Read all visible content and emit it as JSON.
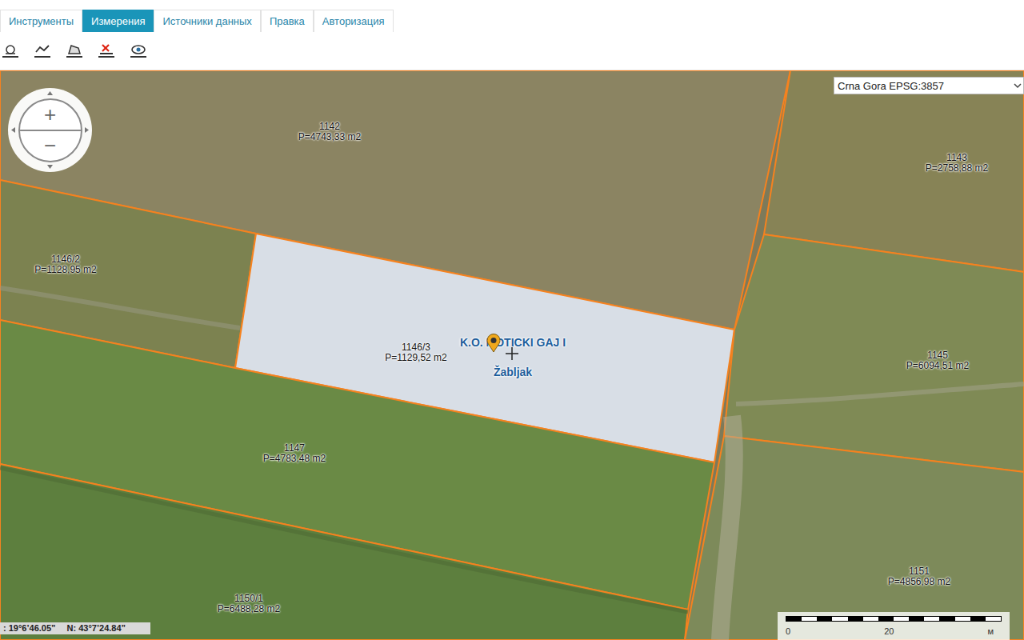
{
  "tabs": [
    {
      "label": "Инструменты",
      "selected": false
    },
    {
      "label": "Измерения",
      "selected": true
    },
    {
      "label": "Источники данных",
      "selected": false
    },
    {
      "label": "Правка",
      "selected": false
    },
    {
      "label": "Авторизация",
      "selected": false
    }
  ],
  "projection": {
    "value": "Crna Gora EPSG:3857"
  },
  "zoom": {
    "in": "+",
    "out": "−"
  },
  "parcels": [
    {
      "number": "1142",
      "area": "P=4743,33 m2",
      "selected": false
    },
    {
      "number": "1143",
      "area": "P=2758,88 m2",
      "selected": false
    },
    {
      "number": "1146/2",
      "area": "P=1128,95 m2",
      "selected": false
    },
    {
      "number": "1146/3",
      "area": "P=1129,52 m2",
      "selected": true
    },
    {
      "number": "1145",
      "area": "P=6094,51 m2",
      "selected": false
    },
    {
      "number": "1147",
      "area": "P=4783,48 m2",
      "selected": false
    },
    {
      "number": "1150/1",
      "area": "P=6488,28 m2",
      "selected": false
    },
    {
      "number": "1151",
      "area": "P=4856,98 m2",
      "selected": false
    }
  ],
  "location": {
    "cadastral_zone": "K.O. MOTICKI GAJ I",
    "municipality": "Žabljak"
  },
  "coordinates": {
    "easting": ": 19°6’46.05”",
    "northing": "N: 43°7’24.84”"
  },
  "scale": {
    "start": "0",
    "mid": "20",
    "unit": "м"
  }
}
